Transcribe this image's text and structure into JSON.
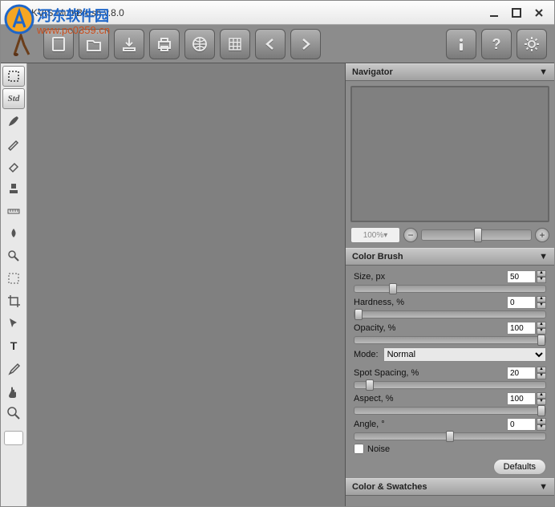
{
  "window": {
    "title": "AKVIS MultiBrush v.8.0",
    "watermark_line1": "河东软件园",
    "watermark_line2": "www.pc0359.cn"
  },
  "toolbar": {
    "items": [
      "brush-app",
      "new",
      "open",
      "save",
      "print",
      "web",
      "grid",
      "prev",
      "next",
      "info",
      "help",
      "settings"
    ]
  },
  "tools": {
    "items": [
      "selection",
      "std",
      "brush",
      "pencil",
      "eraser",
      "stamp",
      "ruler",
      "droplet",
      "zoom-tool",
      "marquee",
      "crop",
      "pointer",
      "text",
      "eyedropper",
      "hand",
      "magnifier"
    ]
  },
  "panels": {
    "navigator": {
      "title": "Navigator",
      "zoom_value": "100%",
      "zoom_handle_pct": 48
    },
    "colorBrush": {
      "title": "Color Brush",
      "size": {
        "label": "Size, px",
        "value": "50",
        "handle_pct": 18
      },
      "hardness": {
        "label": "Hardness, %",
        "value": "0",
        "handle_pct": 0
      },
      "opacity": {
        "label": "Opacity, %",
        "value": "100",
        "handle_pct": 100
      },
      "mode_label": "Mode:",
      "mode_value": "Normal",
      "spacing": {
        "label": "Spot Spacing, %",
        "value": "20",
        "handle_pct": 6
      },
      "aspect": {
        "label": "Aspect, %",
        "value": "100",
        "handle_pct": 100
      },
      "angle": {
        "label": "Angle, °",
        "value": "0",
        "handle_pct": 50
      },
      "noise_label": "Noise",
      "defaults_label": "Defaults"
    },
    "swatches": {
      "title": "Color & Swatches"
    }
  }
}
